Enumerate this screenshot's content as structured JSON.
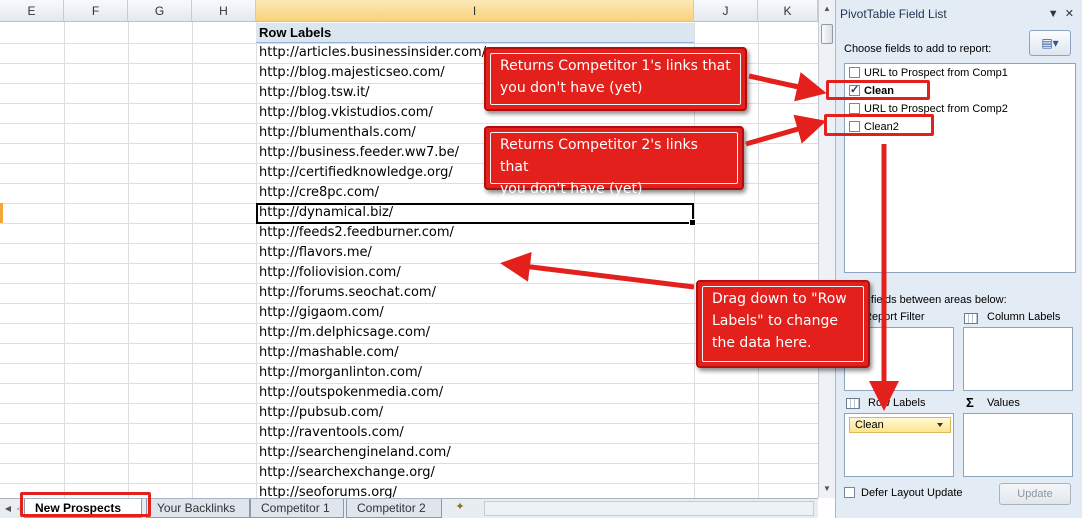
{
  "columns": [
    {
      "letter": "E"
    },
    {
      "letter": "F"
    },
    {
      "letter": "G"
    },
    {
      "letter": "H"
    },
    {
      "letter": "I"
    },
    {
      "letter": "J"
    },
    {
      "letter": "K"
    }
  ],
  "pivot_table": {
    "header": "Row Labels",
    "rows": [
      "http://articles.businessinsider.com/",
      "http://blog.majesticseo.com/",
      "http://blog.tsw.it/",
      "http://blog.vkistudios.com/",
      "http://blumenthals.com/",
      "http://business.feeder.ww7.be/",
      "http://certifiedknowledge.org/",
      "http://cre8pc.com/",
      "http://dynamical.biz/",
      "http://feeds2.feedburner.com/",
      "http://flavors.me/",
      "http://foliovision.com/",
      "http://forums.seochat.com/",
      "http://gigaom.com/",
      "http://m.delphicsage.com/",
      "http://mashable.com/",
      "http://morganlinton.com/",
      "http://outspokenmedia.com/",
      "http://pubsub.com/",
      "http://raventools.com/",
      "http://searchengineland.com/",
      "http://searchexchange.org/",
      "http://seoforums.org/"
    ]
  },
  "callouts": {
    "comp1": {
      "line1": "Returns Competitor 1's links that",
      "line2": "you don't have (yet)"
    },
    "comp2": {
      "line1": "Returns Competitor 2's links that",
      "line2": "you don't have (yet)"
    },
    "drag": {
      "line1": "Drag down to \"Row",
      "line2": "Labels\" to change",
      "line3": "the data here."
    }
  },
  "sheet_tabs": [
    {
      "label": "New Prospects",
      "active": true
    },
    {
      "label": "Your Backlinks",
      "active": false
    },
    {
      "label": "Competitor 1",
      "active": false
    },
    {
      "label": "Competitor 2",
      "active": false
    }
  ],
  "field_list": {
    "title": "PivotTable Field List",
    "choose_label": "Choose fields to add to report:",
    "fields": [
      {
        "label": "URL to Prospect from Comp1",
        "checked": false,
        "bold": false
      },
      {
        "label": "Clean",
        "checked": true,
        "bold": true
      },
      {
        "label": "URL to Prospect from Comp2",
        "checked": false,
        "bold": false
      },
      {
        "label": "Clean2",
        "checked": false,
        "bold": false
      }
    ],
    "drag_label": "Drag fields between areas below:",
    "areas": {
      "report_filter": "Report Filter",
      "column_labels": "Column Labels",
      "row_labels": "Row Labels",
      "values": "Values"
    },
    "row_field": "Clean",
    "defer_label": "Defer Layout Update",
    "update_label": "Update"
  },
  "colors": {
    "callout_red": "#e3201b",
    "pivot_header_bg": "#dce6f1",
    "panel_bg": "#e3ebf5"
  }
}
